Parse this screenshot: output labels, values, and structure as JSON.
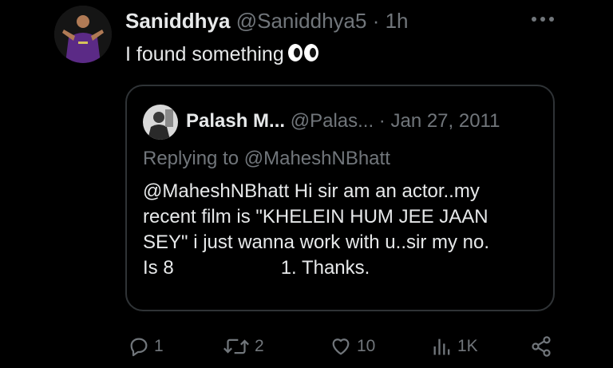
{
  "author": {
    "display_name": "Saniddhya",
    "handle": "@Saniddhya5",
    "separator": "·",
    "time": "1h"
  },
  "tweet": {
    "text": "I found something"
  },
  "quoted": {
    "display_name": "Palash M...",
    "handle": "@Palas...",
    "separator": "·",
    "date": "Jan 27, 2011",
    "reply_prefix": "Replying to",
    "reply_to": "@MaheshNBhatt",
    "body_lines": [
      "@MaheshNBhatt Hi sir am an actor..my",
      "recent film is \"KHELEIN HUM JEE JAAN",
      "SEY\" i just wanna work with u..sir my no.",
      "Is 8"
    ],
    "body_line4_end": "1. Thanks."
  },
  "actions": {
    "replies": "1",
    "reposts": "2",
    "likes": "10",
    "views": "1K"
  },
  "colors": {
    "background": "#000000",
    "text": "#e7e9ea",
    "muted": "#71767b",
    "border": "#2f3336",
    "jersey": "#5b2a86"
  }
}
